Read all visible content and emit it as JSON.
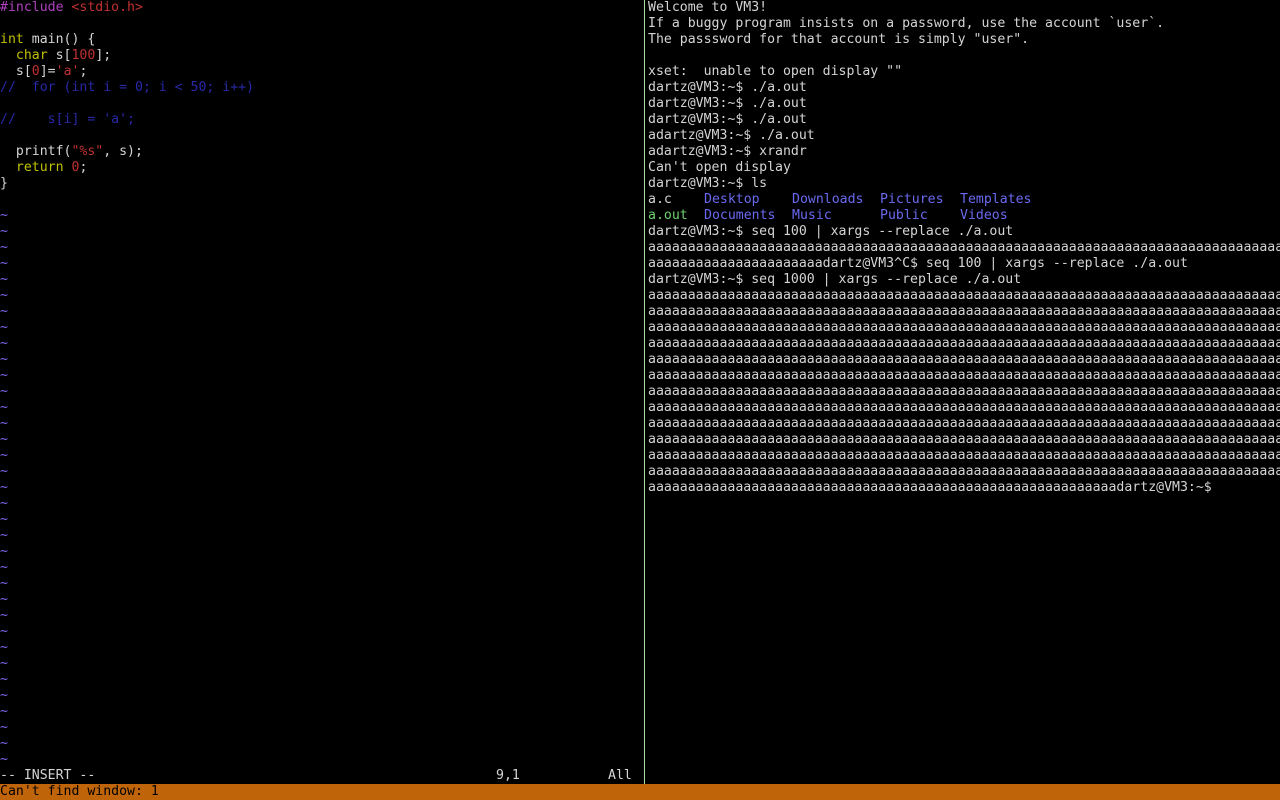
{
  "editor": {
    "code": {
      "l1_pre": "#include ",
      "l1_hdr": "<stdio.h>",
      "l3_type": "int",
      "l3_rest": " main() {",
      "l4_type": "char",
      "l4_a": " s[",
      "l4_num": "100",
      "l4_b": "];",
      "l5_a": "s[",
      "l5_num": "0",
      "l5_b": "]=",
      "l5_str": "'a'",
      "l5_c": ";",
      "l6_comment": "//  for (int i = 0; i < 50; i++)",
      "l8_comment": "//    s[i] = 'a';",
      "l10_a": "printf(",
      "l10_str": "\"%s\"",
      "l10_b": ", s);",
      "l11_kw": "return",
      "l11_num": "0",
      "l11_b": ";",
      "l12": "}"
    },
    "tilde": "~",
    "mode": "-- INSERT --",
    "position": "9,1",
    "scroll": "All"
  },
  "status_message": "Can't find window: 1",
  "terminal": {
    "welcome": "Welcome to VM3!",
    "info1": "If a buggy program insists on a password, use the account `user`.",
    "info2": "The passsword for that account is simply \"user\".",
    "xset": "xset:  unable to open display \"\"",
    "cmd1": "dartz@VM3:~$ ./a.out",
    "cmd2": "dartz@VM3:~$ ./a.out",
    "cmd3": "dartz@VM3:~$ ./a.out",
    "cmd4": "adartz@VM3:~$ ./a.out",
    "cmd5": "adartz@VM3:~$ xrandr",
    "cant_open": "Can't open display",
    "cmd6": "dartz@VM3:~$ ls",
    "ls_files": [
      "a.c",
      "Desktop",
      "Downloads",
      "Pictures",
      "Templates",
      "a.out",
      "Documents",
      "Music",
      "Public",
      "Videos"
    ],
    "cmd7": "dartz@VM3:~$ seq 100 | xargs --replace ./a.out",
    "out_a1": "aaaaaaaaaaaaaaaaaaaaaaaaaaaaaaaaaaaaaaaaaaaaaaaaaaaaaaaaaaaaaaaaaaaaaaaaaaaaaaaaa",
    "out_a2": "aaaaaaaaaaaaaaaaaaaaaadartz@VM3^C$ seq 100 | xargs --replace ./a.out",
    "cmd8": "dartz@VM3:~$ seq 1000 | xargs --replace ./a.out",
    "out_full": "aaaaaaaaaaaaaaaaaaaaaaaaaaaaaaaaaaaaaaaaaaaaaaaaaaaaaaaaaaaaaaaaaaaaaaaaaaaaaaaaa",
    "out_last": "aaaaaaaaaaaaaaaaaaaaaaaaaaaaaaaaaaaaaaaaaaaaaaaaaaaaaaaaaaadartz@VM3:~$"
  },
  "colors": {
    "status_bar": "#c0640a",
    "divider": "#a8d8a0",
    "tilde": "#7b68ee",
    "directory": "#6a6af0",
    "executable": "#70d070"
  }
}
